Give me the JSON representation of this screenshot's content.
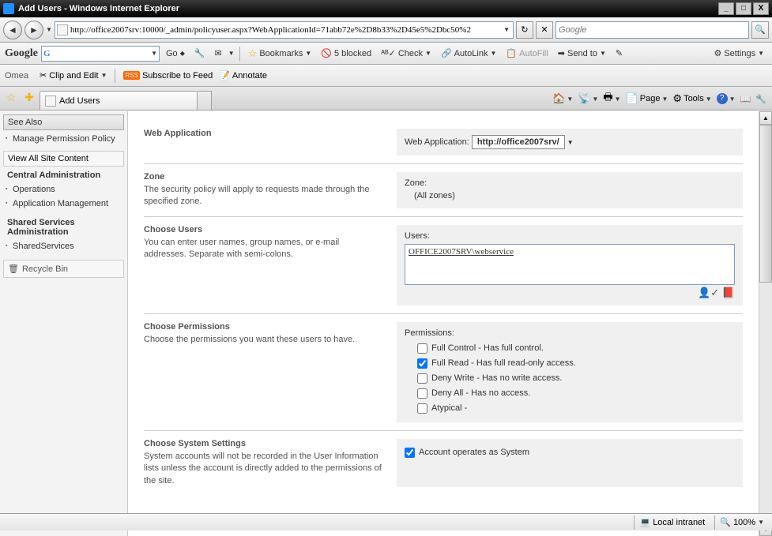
{
  "window": {
    "title": "Add Users - Windows Internet Explorer",
    "min": "_",
    "max": "□",
    "close": "X"
  },
  "nav": {
    "url": "http://office2007srv:10000/_admin/policyuser.aspx?WebApplicationId=71abb72e%2D8b33%2D45e5%2Dbc50%2",
    "search_placeholder": "Google",
    "refresh": "↻",
    "stop": "✕"
  },
  "gbar": {
    "logo": "Google",
    "go": "Go",
    "bookmarks": "Bookmarks",
    "blocked": "5 blocked",
    "check": "Check",
    "autolink": "AutoLink",
    "autofill": "AutoFill",
    "sendto": "Send to",
    "settings": "Settings"
  },
  "obar": {
    "label": "Omea",
    "clip": "Clip and Edit",
    "subscribe": "Subscribe to Feed",
    "annotate": "Annotate"
  },
  "tabbar": {
    "tab_title": "Add Users",
    "page": "Page",
    "tools": "Tools"
  },
  "sidebar": {
    "see_also": "See Also",
    "manage_permission": "Manage Permission Policy",
    "view_all": "View All Site Content",
    "central_admin": "Central Administration",
    "operations": "Operations",
    "app_mgmt": "Application Management",
    "shared_admin": "Shared Services Administration",
    "shared_services": "SharedServices",
    "recycle": "Recycle Bin"
  },
  "form": {
    "webapp": {
      "title": "Web Application",
      "label": "Web Application:",
      "value": "http://office2007srv/"
    },
    "zone": {
      "title": "Zone",
      "desc": "The security policy will apply to requests made through the specified zone.",
      "label": "Zone:",
      "value": "(All zones)"
    },
    "users": {
      "title": "Choose Users",
      "desc": "You can enter user names, group names, or e-mail addresses. Separate with semi-colons.",
      "label": "Users:",
      "value": "OFFICE2007SRV\\webservice"
    },
    "perms": {
      "title": "Choose Permissions",
      "desc": "Choose the permissions you want these users to have.",
      "label": "Permissions:",
      "items": [
        {
          "label": "Full Control - Has full control.",
          "checked": false
        },
        {
          "label": "Full Read - Has full read-only access.",
          "checked": true
        },
        {
          "label": "Deny Write - Has no write access.",
          "checked": false
        },
        {
          "label": "Deny All - Has no access.",
          "checked": false
        },
        {
          "label": "Atypical -",
          "checked": false
        }
      ]
    },
    "system": {
      "title": "Choose System Settings",
      "desc": "System accounts will not be recorded in the User Information lists unless the account is directly added to the permissions of the site.",
      "label": "Account operates as System",
      "checked": true
    }
  },
  "status": {
    "zone": "Local intranet",
    "zoom": "100%"
  }
}
